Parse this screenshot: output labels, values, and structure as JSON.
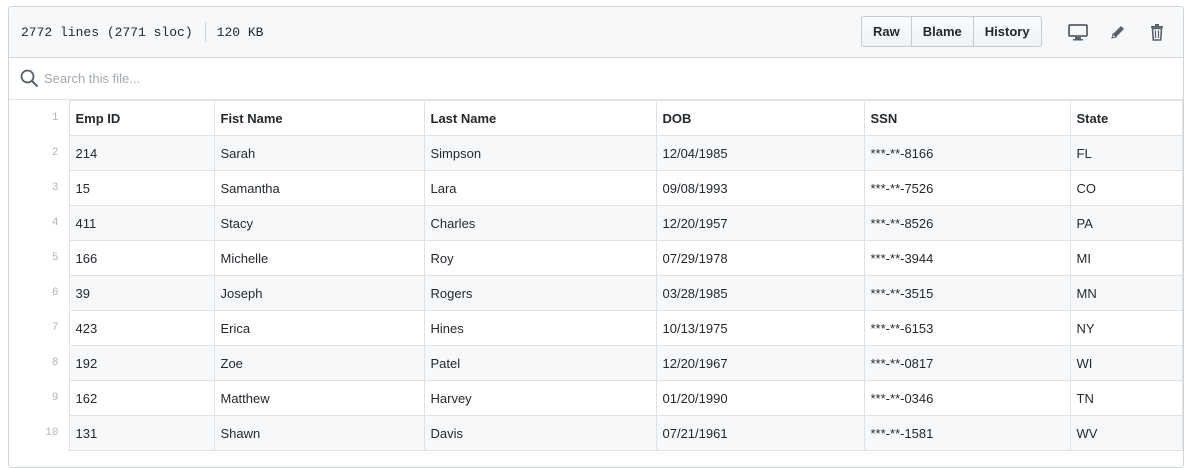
{
  "file_info": {
    "lines": "2772 lines (2771 sloc)",
    "size": "120 KB"
  },
  "toolbar": {
    "raw": "Raw",
    "blame": "Blame",
    "history": "History"
  },
  "search": {
    "placeholder": "Search this file..."
  },
  "table": {
    "headers": [
      "Emp ID",
      "Fist Name",
      "Last Name",
      "DOB",
      "SSN",
      "State"
    ],
    "header_line": "1",
    "rows": [
      {
        "line": "2",
        "cells": [
          "214",
          "Sarah",
          "Simpson",
          "12/04/1985",
          "***-**-8166",
          "FL"
        ]
      },
      {
        "line": "3",
        "cells": [
          "15",
          "Samantha",
          "Lara",
          "09/08/1993",
          "***-**-7526",
          "CO"
        ]
      },
      {
        "line": "4",
        "cells": [
          "411",
          "Stacy",
          "Charles",
          "12/20/1957",
          "***-**-8526",
          "PA"
        ]
      },
      {
        "line": "5",
        "cells": [
          "166",
          "Michelle",
          "Roy",
          "07/29/1978",
          "***-**-3944",
          "MI"
        ]
      },
      {
        "line": "6",
        "cells": [
          "39",
          "Joseph",
          "Rogers",
          "03/28/1985",
          "***-**-3515",
          "MN"
        ]
      },
      {
        "line": "7",
        "cells": [
          "423",
          "Erica",
          "Hines",
          "10/13/1975",
          "***-**-6153",
          "NY"
        ]
      },
      {
        "line": "8",
        "cells": [
          "192",
          "Zoe",
          "Patel",
          "12/20/1967",
          "***-**-0817",
          "WI"
        ]
      },
      {
        "line": "9",
        "cells": [
          "162",
          "Matthew",
          "Harvey",
          "01/20/1990",
          "***-**-0346",
          "TN"
        ]
      },
      {
        "line": "10",
        "cells": [
          "131",
          "Shawn",
          "Davis",
          "07/21/1961",
          "***-**-1581",
          "WV"
        ]
      }
    ]
  },
  "icons": {
    "display": "desktop-icon",
    "edit": "pencil-icon",
    "delete": "trash-icon",
    "search": "search-icon"
  }
}
